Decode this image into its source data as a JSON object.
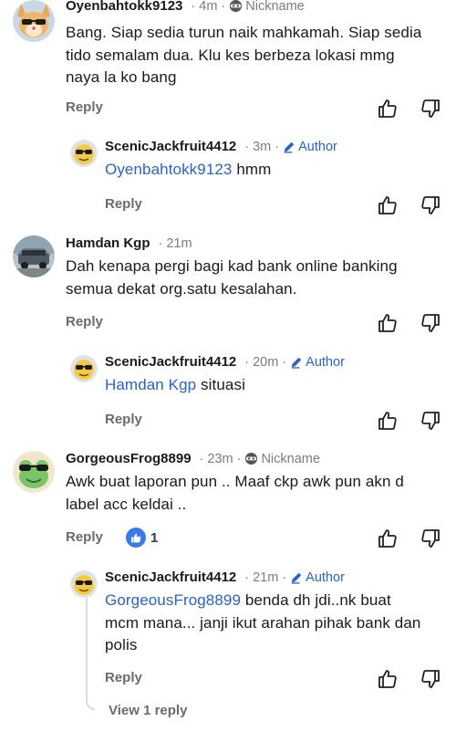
{
  "comments": [
    {
      "username": "Oyenbahtokk9123",
      "time": "4m",
      "badge": "Nickname",
      "body_lines": [
        "Bang. Siap sedia turun naik mahkamah. Siap sedia",
        "tido semalam dua. Klu kes berbeza lokasi mmg",
        "naya la ko bang"
      ],
      "reply_label": "Reply"
    },
    {
      "username": "ScenicJackfruit4412",
      "time": "3m",
      "badge": "Author",
      "mention": "Oyenbahtokk9123",
      "body_text": " hmm",
      "reply_label": "Reply"
    },
    {
      "username": "Hamdan Kgp",
      "time": "21m",
      "body_lines": [
        "Dah kenapa pergi bagi kad bank online banking",
        "semua dekat org.satu kesalahan."
      ],
      "reply_label": "Reply"
    },
    {
      "username": "ScenicJackfruit4412",
      "time": "20m",
      "badge": "Author",
      "mention": "Hamdan Kgp",
      "body_text": " situasi",
      "reply_label": "Reply"
    },
    {
      "username": "GorgeousFrog8899",
      "time": "23m",
      "badge": "Nickname",
      "body_lines": [
        "Awk buat laporan pun .. Maaf ckp awk pun akn d",
        "label acc keldai .."
      ],
      "reply_label": "Reply",
      "like_count": "1"
    },
    {
      "username": "ScenicJackfruit4412",
      "time": "21m",
      "badge": "Author",
      "mention": "GorgeousFrog8899",
      "body_first": " benda dh jdi..nk buat",
      "body_lines": [
        "mcm mana... janji ikut arahan pihak bank dan",
        "polis"
      ],
      "reply_label": "Reply"
    }
  ],
  "view_replies_label": "View 1 reply",
  "colors": {
    "link": "#2a62c8",
    "muted": "#7c7c7c",
    "like_bubble": "#3b7be8"
  },
  "icons": [
    "cat-avatar-icon",
    "sunglasses-emoji-avatar-icon",
    "car-photo-avatar-icon",
    "frog-avatar-icon",
    "eye-mask-icon",
    "pencil-icon",
    "thumbs-up-icon",
    "thumbs-down-icon"
  ]
}
